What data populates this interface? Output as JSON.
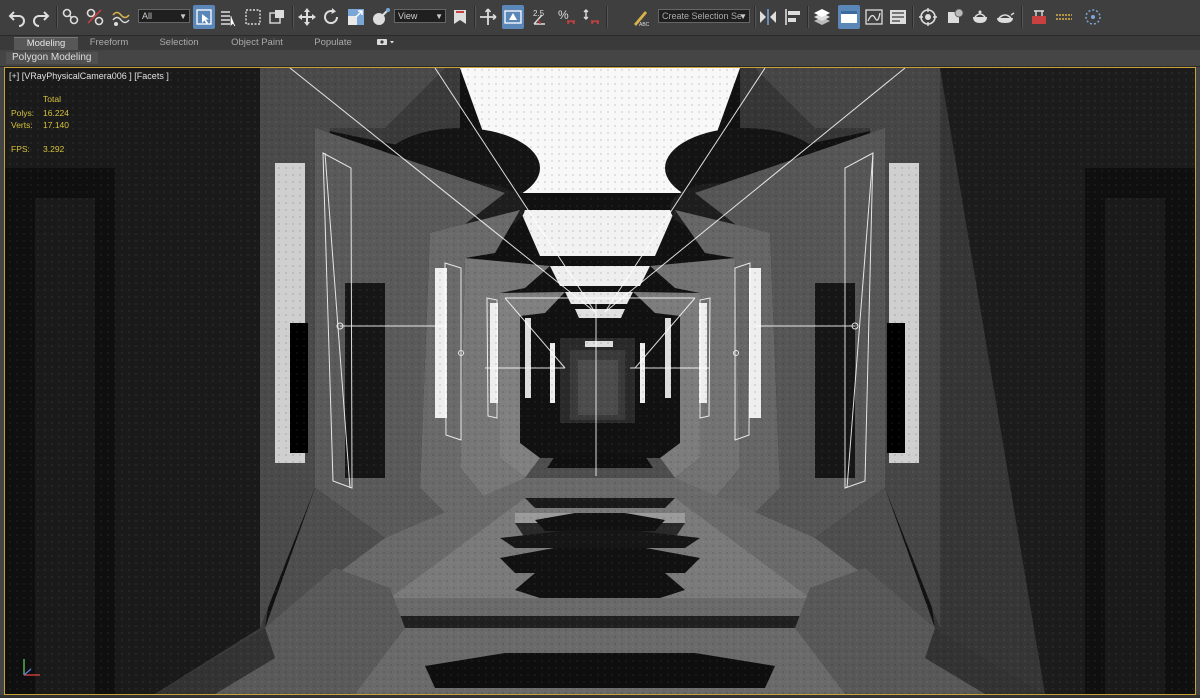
{
  "toolbar": {
    "selection_filter": "All",
    "reference_coord": "View",
    "named_selection_placeholder": "Create Selection Se",
    "snap_angle": "2.5",
    "icons": [
      "undo-icon",
      "redo-icon",
      "link-icon",
      "unlink-icon",
      "bind-space-warp-icon",
      "select-object-icon",
      "select-by-name-icon",
      "rectangular-selection-icon",
      "window-crossing-icon",
      "move-icon",
      "rotate-icon",
      "scale-icon",
      "select-manipulate-icon",
      "keyboard-shortcut-icon",
      "pivot-center-icon",
      "snaps-toggle-icon",
      "angle-snap-icon",
      "percent-snap-icon",
      "spinner-snap-icon",
      "edit-named-selection-icon",
      "mirror-icon",
      "align-icon",
      "scene-explorer-icon",
      "layer-explorer-icon",
      "ribbon-toggle-icon",
      "curve-editor-icon",
      "schematic-view-icon",
      "material-editor-icon",
      "render-setup-icon",
      "rendered-frame-icon",
      "render-production-icon",
      "vray-frame-buffer-icon",
      "vray-tools-icon",
      "vray-lister-icon"
    ]
  },
  "ribbon": {
    "tabs": [
      "Modeling",
      "Freeform",
      "Selection",
      "Object Paint",
      "Populate"
    ],
    "active_tab": "Modeling",
    "panel_label": "Polygon Modeling"
  },
  "viewport": {
    "label": "[+] [VRayPhysicalCamera006 ] [Facets ]",
    "stats": {
      "header": "Total",
      "polys_label": "Polys:",
      "polys_value": "16.224",
      "verts_label": "Verts:",
      "verts_value": "17.140",
      "fps_label": "FPS:",
      "fps_value": "3.292"
    }
  },
  "colors": {
    "toolbar_bg": "#3f3f3f",
    "active_button": "#5b87b8",
    "viewport_border": "#c9a13a",
    "stats_text": "#d6c23c"
  }
}
